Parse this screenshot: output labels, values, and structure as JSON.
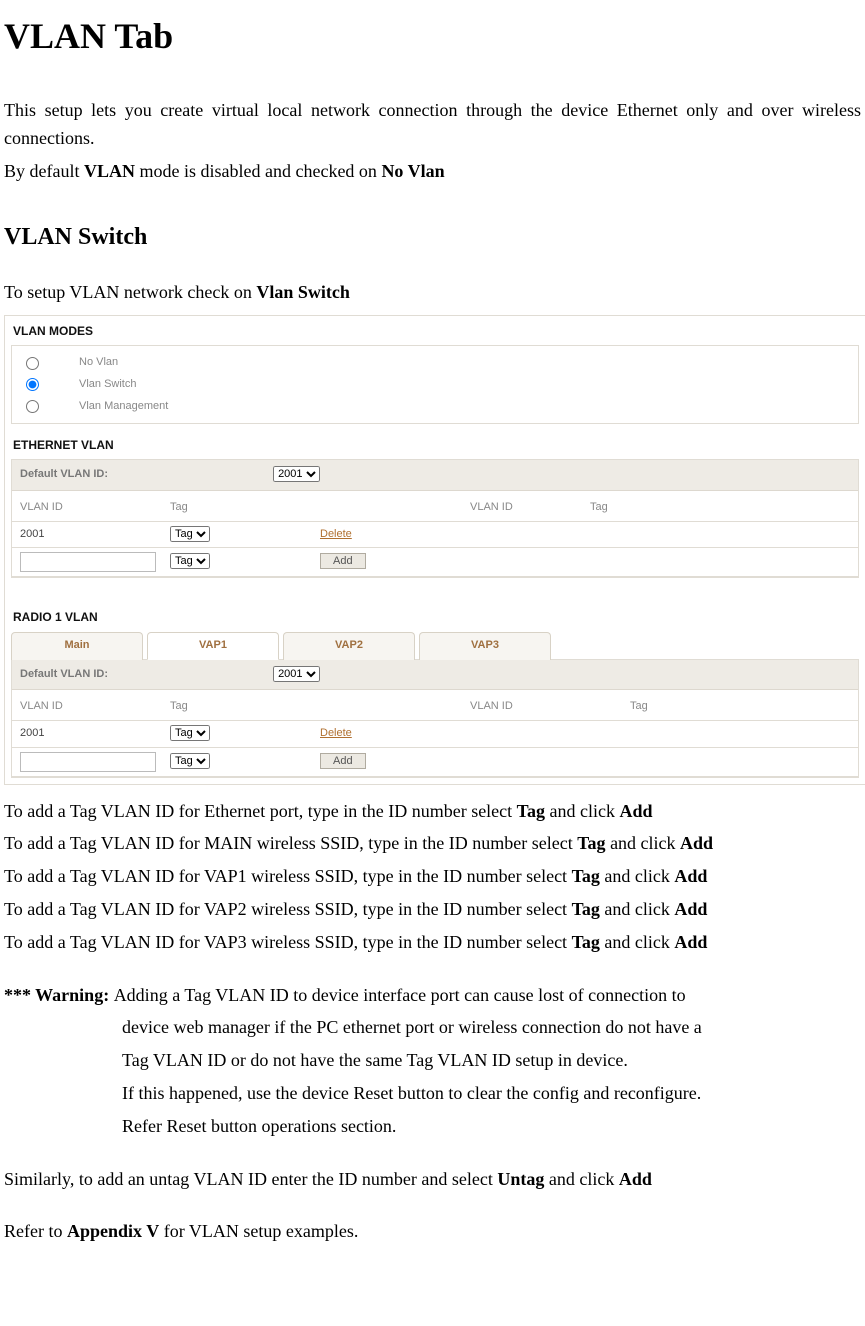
{
  "title": "VLAN Tab",
  "intro1": "This setup lets you create virtual local network connection through the device Ethernet only and over wireless connections.",
  "intro2a": "By default ",
  "intro2b": "VLAN",
  "intro2c": " mode is disabled and checked on ",
  "intro2d": "No Vlan",
  "h2": "VLAN Switch",
  "setup1a": "To setup VLAN network check on ",
  "setup1b": "Vlan Switch",
  "fig": {
    "modes_title": "VLAN MODES",
    "modes": [
      "No Vlan",
      "Vlan Switch",
      "Vlan Management"
    ],
    "eth_title": "ETHERNET VLAN",
    "default_label": "Default VLAN ID:",
    "default_val": "2001",
    "hdr_vlanid": "VLAN ID",
    "hdr_tag": "Tag",
    "row_id": "2001",
    "row_tag": "Tag",
    "delete": "Delete",
    "add": "Add",
    "radio_title": "RADIO 1 VLAN",
    "tabs": [
      "Main",
      "VAP1",
      "VAP2",
      "VAP3"
    ]
  },
  "after": {
    "l1a": "To add a Tag VLAN ID for Ethernet port, type in the ID number select ",
    "l1b": "Tag",
    "l1c": " and click ",
    "l1d": "Add",
    "l2a": "To add a Tag VLAN ID for MAIN wireless SSID, type in the ID number select ",
    "l3a": "To add a Tag VLAN ID for VAP1 wireless SSID, type in the ID number select ",
    "l4a": "To add a Tag VLAN ID for VAP2 wireless SSID, type in the ID number select ",
    "l5a": "To add a Tag VLAN ID for VAP3 wireless SSID, type in the ID number select "
  },
  "warn_label": "*** Warning: ",
  "warn1": "Adding a Tag VLAN ID to device interface port can cause lost of connection to",
  "warn2": "device web manager if the PC ethernet port or wireless connection do not have a",
  "warn3": "Tag VLAN ID or do not have the same Tag VLAN ID setup in device.",
  "warn4": "If this happened, use the device Reset button to clear the config and reconfigure.",
  "warn5": "Refer Reset button operations section.",
  "sim1a": "Similarly, to add an untag VLAN ID enter the ID number and select ",
  "sim1b": "Untag",
  "sim1c": " and click ",
  "sim1d": "Add",
  "ref1a": "Refer to ",
  "ref1b": "Appendix V",
  "ref1c": " for VLAN setup examples."
}
